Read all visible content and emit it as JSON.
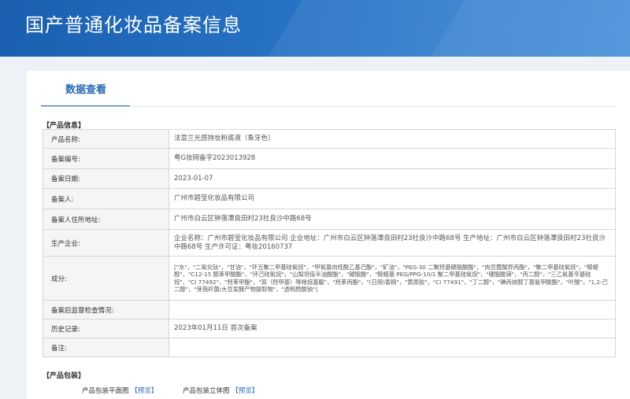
{
  "page_title": "国产普通化妆品备案信息",
  "tab_label": "数据查看",
  "section_product_info": "【产品信息】",
  "rows": [
    {
      "label": "产品名称:",
      "value": "法意兰光感持妆粉底液（象牙色）"
    },
    {
      "label": "备案编号:",
      "value": "粤G妆网备字2023013928"
    },
    {
      "label": "备案日期:",
      "value": "2023-01-07"
    },
    {
      "label": "备案人:",
      "value": "广州市碧莹化妆品有限公司"
    },
    {
      "label": "备案人住所地址:",
      "value": "广州市白云区钟落潭良田村23社良沙中路68号"
    },
    {
      "label": "生产企业:",
      "value": "企业名称：广州市碧莹化妆品有限公司 企业地址：广州市白云区钟落潭良田村23社良沙中路68号 生产地址：广州市白云区钟落潭良田村23社良沙中路68号 生产许可证：粤妆20160737"
    },
    {
      "label": "成分:",
      "value": "[\"水\"，\"二氧化钛\"，\"甘油\"，\"环五聚二甲基硅氧烷\"，\"甲氧基肉桂酸乙基己酯\"，\"矿油\"，\"PEG-30 二聚羟基硬脂酸酯\"，\"肉豆蔻酸异丙酯\"，\"聚二甲基硅氧烷\"，\"鲸蜡醇\"，\"C12-15 醇苯甲酸酯\"，\"环己硅氧烷\"，\"山梨坦倍半油酸酯\"，\"硬脂酸\"，\"鲸蜡基 PEG/PPG-10/1 聚二甲基硅氧烷\"，\"硬脂酸镁\"，\"丙二醇\"，\"三乙氧基辛基硅烷\"，\"CI 77492\"，\"羟苯甲酯\"，\"双（羟甲基）咪唑烷基脲\"，\"羟苯丙酯\"，\"(日用)香精\"，\"黄原胶\"，\"CI 77491\"，\"丁二醇\"，\"碘丙炔醇丁基氨甲酸酯\"，\"叶酸\"，\"1,2-己二醇\"，\"芽孢杆菌/大豆发酵产物提取物\"，\"透明质酸钠\"]"
    },
    {
      "label": "备案后监督检查情况:",
      "value": ""
    },
    {
      "label": "历史记录:",
      "value": "2023年01月11日 首次备案"
    },
    {
      "label": "备注:",
      "value": ""
    }
  ],
  "section_package": "【产品包装】",
  "package": {
    "flat_label": "产品包装平面图",
    "flat_link": "【预览】",
    "solid_label": "产品包装立体图",
    "solid_link": "【预览】"
  },
  "colors": {
    "header": "#2a76c8",
    "accent": "#2a6ab8",
    "label_bg": "#f4f5f7"
  }
}
